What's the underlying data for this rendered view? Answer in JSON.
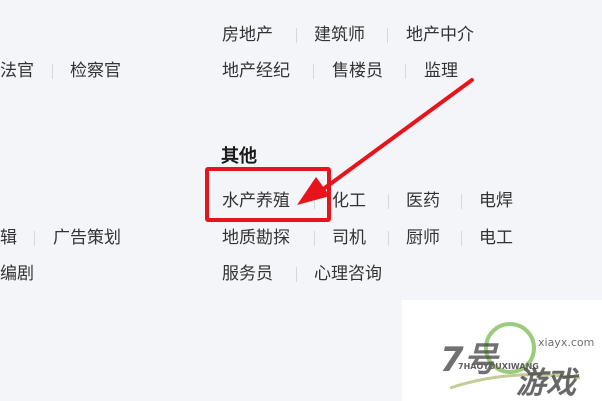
{
  "categories": {
    "top_right_row1": [
      "房地产",
      "建筑师",
      "地产中介"
    ],
    "top_right_row2": [
      "地产经纪",
      "售楼员",
      "监理"
    ],
    "top_left_row2": [
      "法官",
      "检察官"
    ],
    "other_section": {
      "title": "其他",
      "row1": [
        "水产养殖",
        "化工",
        "医药",
        "电焊"
      ],
      "row2": [
        "地质勘探",
        "司机",
        "厨师",
        "电工"
      ],
      "row3": [
        "服务员",
        "心理咨询"
      ]
    },
    "left_mid_row1": [
      "辑",
      "广告策划"
    ],
    "left_mid_row2": [
      "编剧"
    ]
  },
  "annotation": {
    "highlight_target": "水产养殖",
    "box_color": "#e8141c",
    "arrow_color": "#e8141c"
  },
  "watermark": {
    "number": "7号",
    "site": "xiayx.com",
    "pinyin": "7HAOYOUXIWANG",
    "slogan": "游戏",
    "colors": {
      "green": "#6db33f",
      "dark": "#222222",
      "olive": "#8a9a2f"
    }
  }
}
